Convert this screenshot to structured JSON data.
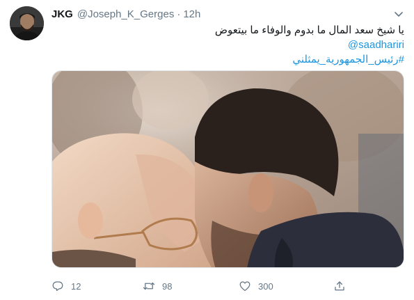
{
  "tweet": {
    "author": {
      "display_name": "JKG",
      "handle": "@Joseph_K_Gerges",
      "separator": "·",
      "time": "12h"
    },
    "text_line": "يا شيخ سعد المال ما بدوم والوفاء ما بيتعوض",
    "mention": "@saadhariri",
    "hashtag": "#رئيس_الجمهورية_يمثلني",
    "actions": {
      "reply_count": "12",
      "retweet_count": "98",
      "like_count": "300"
    }
  },
  "colors": {
    "link": "#1b95e0",
    "secondary_text": "#657786",
    "primary_text": "#14171a"
  },
  "icons": [
    "avatar",
    "chevron-down-icon",
    "reply-icon",
    "retweet-icon",
    "like-icon",
    "share-icon"
  ]
}
